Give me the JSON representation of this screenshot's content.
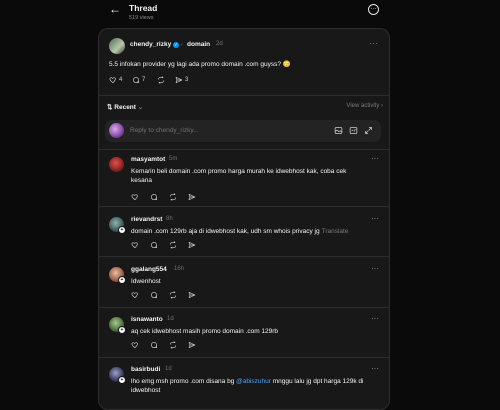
{
  "header": {
    "back_icon": "arrow-left-icon",
    "title": "Thread",
    "views": "519 views",
    "menu_icon": "more-circle-icon"
  },
  "post": {
    "author": "chendy_rizky",
    "verified": true,
    "topic": "domain",
    "time": "2d",
    "text": "5.5 infokan provider yg lagi ada promo domain .com guyss? 😳",
    "likes": "4",
    "replies": "7",
    "shares": "3"
  },
  "sort": {
    "label": "Recent",
    "activity_link": "View activity"
  },
  "reply_box": {
    "placeholder": "Reply to chendy_rizky..."
  },
  "comments": [
    {
      "author": "masyamtot",
      "time": "5m",
      "text": "Kemarin beli domain .com promo harga murah ke idwebhost kak, coba cek kesana",
      "avatar_color": "#7a1a1a"
    },
    {
      "author": "rievandrst",
      "time": "8h",
      "text": "domain .com 129rb aja di idwebhost kak, udh sm whois privacy jg",
      "translate": "Translate",
      "avatar_color": "#3b5b5a"
    },
    {
      "author": "ggalang554",
      "time": "16h",
      "text": "Idwenhost",
      "avatar_color": "#a85a5a"
    },
    {
      "author": "isnawanto",
      "time": "1d",
      "text": "aq cek idwebhost masih promo domain .com 129rb",
      "avatar_color": "#4b6b3b"
    },
    {
      "author": "basirbudi",
      "time": "1d",
      "text_pre": "lho emg msh promo .com disana bg ",
      "mention": "@abiszuhur",
      "text_post": " mnggu lalu jg dpt harga 129k di idwebhost",
      "avatar_color": "#3a3a5a"
    }
  ]
}
